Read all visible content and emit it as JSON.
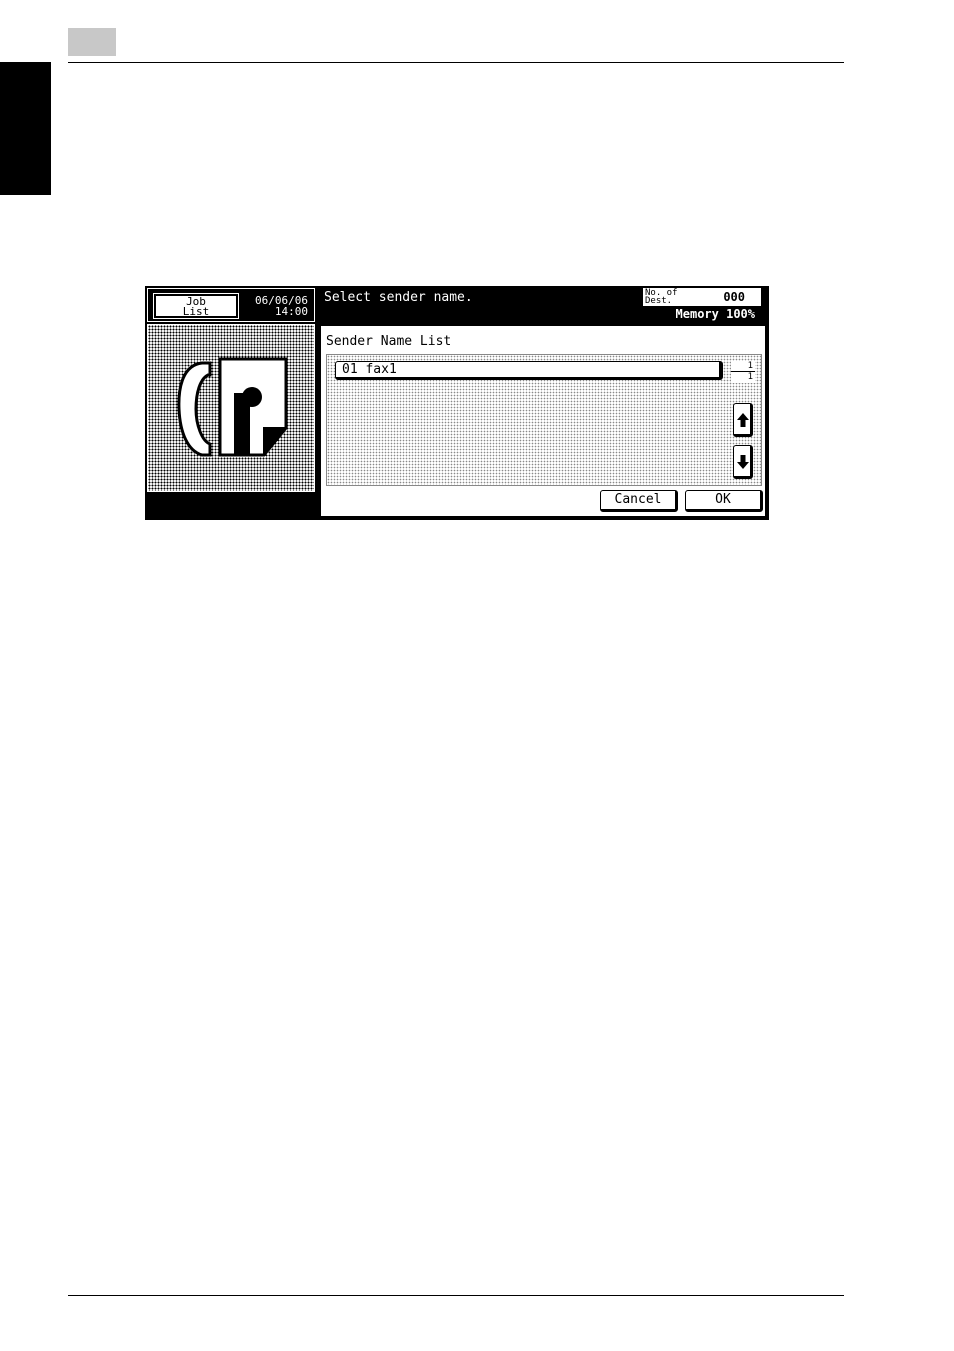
{
  "header": {
    "job_list_line1": "Job",
    "job_list_line2": "List",
    "date": "06/06/06",
    "time": "14:00",
    "message": "Select sender name.",
    "dest_label_line1": "No. of",
    "dest_label_line2": "Dest.",
    "dest_count": "000",
    "memory": "Memory 100%"
  },
  "sender_list": {
    "title": "Sender Name List",
    "items": [
      {
        "label": "01 fax1"
      }
    ],
    "page_current": "1",
    "page_total": "1"
  },
  "buttons": {
    "cancel": "Cancel",
    "ok": "OK"
  },
  "icons": {
    "fax_mode": "fax-phone-icon",
    "scroll_up": "arrow-up-icon",
    "scroll_down": "arrow-down-icon"
  }
}
